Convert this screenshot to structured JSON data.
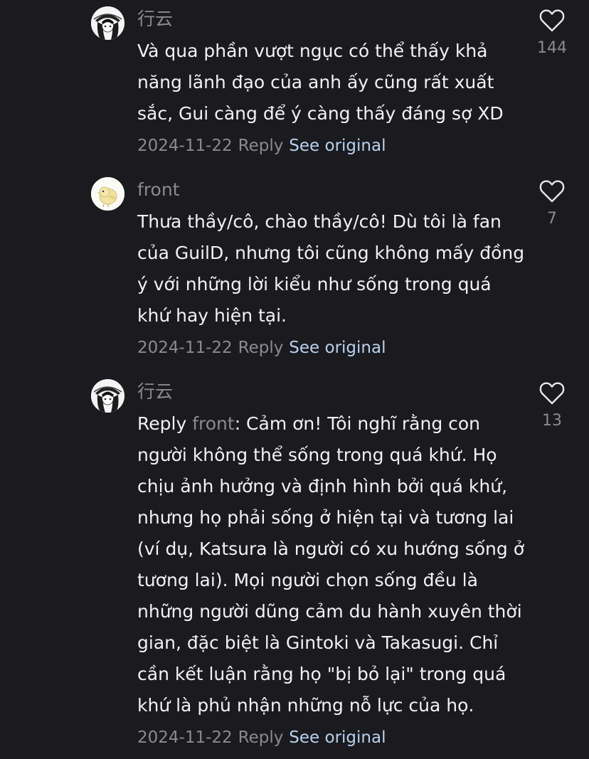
{
  "comments": [
    {
      "username": "行云",
      "text": "Và qua phần vượt ngục có thể thấy khả năng lãnh đạo của anh ấy cũng rất xuất sắc, Gui càng để ý càng thấy đáng sợ XD",
      "date": "2024-11-22",
      "reply_label": "Reply",
      "see_original": "See original",
      "likes": "144",
      "avatar_icon": "anime-girl-avatar-icon"
    },
    {
      "username": "front",
      "text": "Thưa thầy/cô, chào thầy/cô! Dù tôi là fan của GuilD, nhưng tôi cũng không mấy đồng ý với những lời kiểu như sống trong quá khứ hay hiện tại.",
      "date": "2024-11-22",
      "reply_label": "Reply",
      "see_original": "See original",
      "likes": "7",
      "avatar_icon": "yellow-bird-avatar-icon"
    },
    {
      "username": "行云",
      "reply_prefix": "Reply",
      "reply_to": "front",
      "text": ": Cảm ơn! Tôi nghĩ rằng con người không thể sống trong quá khứ. Họ chịu ảnh hưởng và định hình bởi quá khứ, nhưng họ phải sống ở hiện tại và tương lai (ví dụ, Katsura là người có xu hướng sống ở tương lai). Mọi người chọn sống đều là những người dũng cảm du hành xuyên thời gian, đặc biệt là Gintoki và Takasugi. Chỉ cần kết luận rằng họ \"bị bỏ lại\" trong quá khứ là phủ nhận những nỗ lực của họ.",
      "date": "2024-11-22",
      "reply_label": "Reply",
      "see_original": "See original",
      "likes": "13",
      "avatar_icon": "anime-girl-avatar-icon"
    }
  ],
  "colors": {
    "background": "#1a1a1f",
    "text": "#f2f2f2",
    "muted": "#8a8a90",
    "link": "#b8d2ee"
  }
}
